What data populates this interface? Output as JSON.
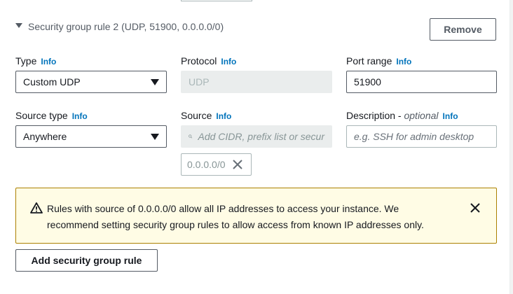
{
  "rule": {
    "header": "Security group rule 2 (UDP, 51900, 0.0.0.0/0)",
    "remove_label": "Remove"
  },
  "fields": {
    "info": "Info",
    "type": {
      "label": "Type",
      "value": "Custom UDP"
    },
    "protocol": {
      "label": "Protocol",
      "value": "UDP"
    },
    "port_range": {
      "label": "Port range",
      "value": "51900"
    },
    "source_type": {
      "label": "Source type",
      "value": "Anywhere"
    },
    "source": {
      "label": "Source",
      "placeholder": "Add CIDR, prefix list or secur",
      "token": "0.0.0.0/0"
    },
    "description": {
      "label": "Description",
      "optional": "optional",
      "separator": " - ",
      "placeholder": "e.g. SSH for admin desktop"
    }
  },
  "alert": {
    "text": "Rules with source of 0.0.0.0/0 allow all IP addresses to access your instance. We recommend setting security group rules to allow access from known IP addresses only."
  },
  "add_rule_label": "Add security group rule",
  "colors": {
    "info_link": "#0073bb",
    "warning_border": "#ac8000",
    "warning_bg": "#fffce5"
  }
}
